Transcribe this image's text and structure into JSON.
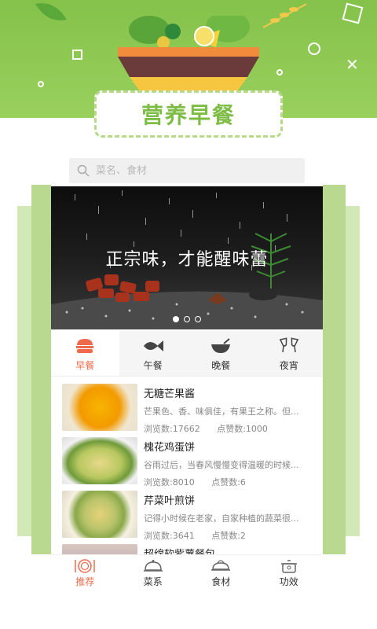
{
  "header": {
    "title": "营养早餐"
  },
  "search": {
    "placeholder": "菜名、食材"
  },
  "banner": {
    "text": "正宗味，才能醒味蕾",
    "dots": 3,
    "active_dot": 0
  },
  "meal_tabs": [
    {
      "label": "早餐",
      "icon": "burger-icon",
      "active": true
    },
    {
      "label": "午餐",
      "icon": "fish-icon",
      "active": false
    },
    {
      "label": "晚餐",
      "icon": "bowl-icon",
      "active": false
    },
    {
      "label": "夜宵",
      "icon": "wine-glasses-icon",
      "active": false
    }
  ],
  "recipes": [
    {
      "title": "无糖芒果酱",
      "desc": "芒果色、香、味俱佳，有果王之称。但...",
      "views_label": "浏览数:17662",
      "likes_label": "点赞数:1000"
    },
    {
      "title": "槐花鸡蛋饼",
      "desc": "谷雨过后，当春风慢慢变得温暖的时候...",
      "views_label": "浏览数:8010",
      "likes_label": "点赞数:6"
    },
    {
      "title": "芹菜叶煎饼",
      "desc": "记得小时候在老家，自家种植的蔬菜很...",
      "views_label": "浏览数:3641",
      "likes_label": "点赞数:2"
    },
    {
      "title": "超绵软紫薯餐包",
      "desc": "",
      "views_label": "",
      "likes_label": ""
    }
  ],
  "bottom_nav": [
    {
      "label": "推荐",
      "icon": "plate-cutlery-icon",
      "active": true
    },
    {
      "label": "菜系",
      "icon": "cloche-icon",
      "active": false
    },
    {
      "label": "食材",
      "icon": "chicken-icon",
      "active": false
    },
    {
      "label": "功效",
      "icon": "pot-icon",
      "active": false
    }
  ],
  "colors": {
    "brand_green": "#84c24a",
    "accent": "#ee6a4c",
    "title_green": "#7dbd45"
  }
}
